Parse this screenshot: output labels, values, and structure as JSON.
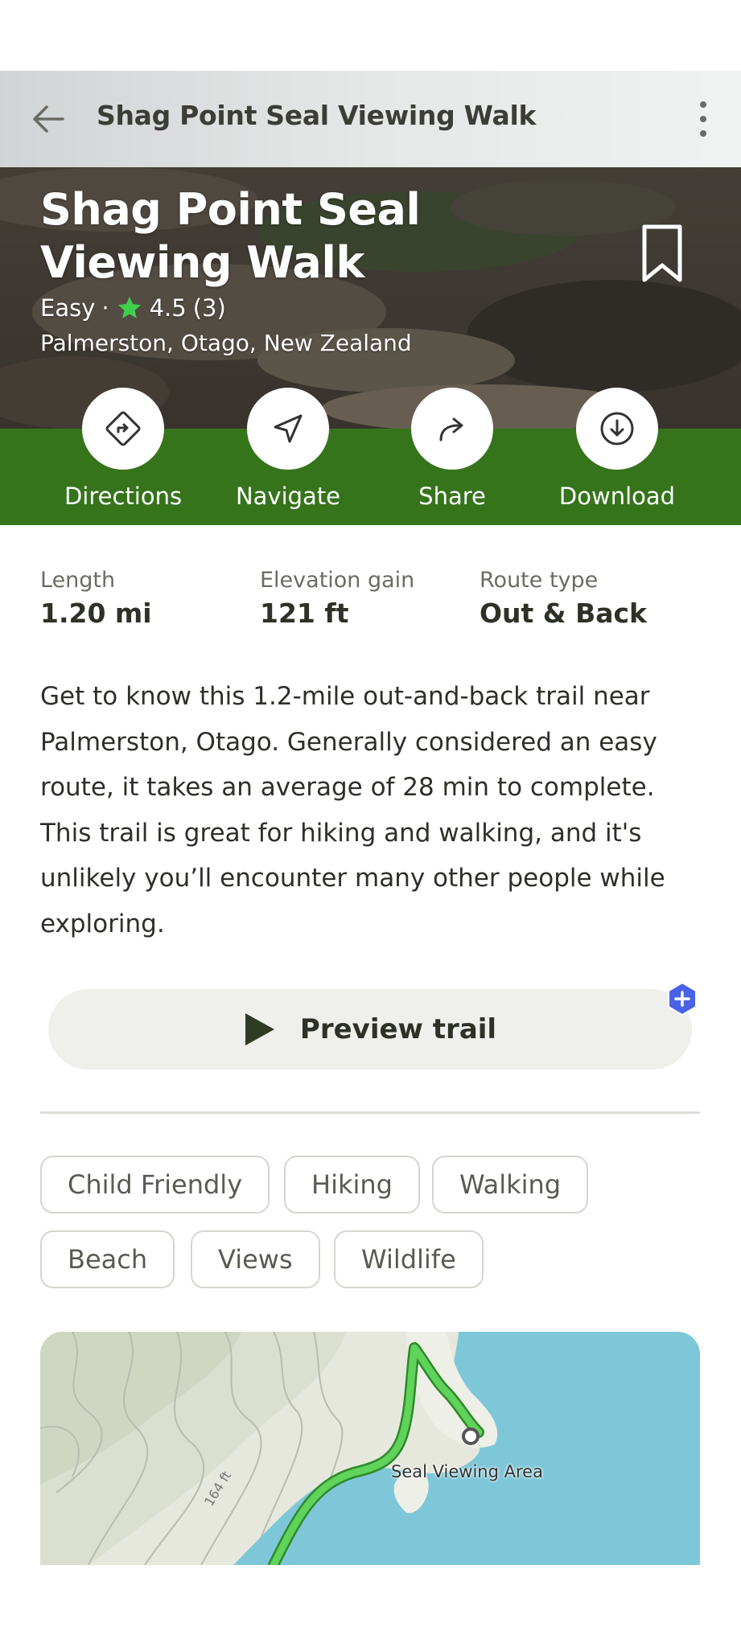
{
  "topbar": {
    "title": "Shag Point Seal Viewing Walk"
  },
  "hero": {
    "title": "Shag Point Seal Viewing Walk",
    "difficulty": "Easy",
    "separator": "·",
    "rating": "4.5",
    "review_count": "(3)",
    "location": "Palmerston, Otago, New Zealand"
  },
  "actions": [
    {
      "label": "Directions",
      "icon": "directions-icon"
    },
    {
      "label": "Navigate",
      "icon": "navigate-icon"
    },
    {
      "label": "Share",
      "icon": "share-icon"
    },
    {
      "label": "Download",
      "icon": "download-icon"
    }
  ],
  "stats": [
    {
      "label": "Length",
      "value": "1.20 mi"
    },
    {
      "label": "Elevation gain",
      "value": "121 ft"
    },
    {
      "label": "Route type",
      "value": "Out & Back"
    }
  ],
  "description": "Get to know this 1.2-mile out-and-back trail near Palmerston, Otago. Generally considered an easy route, it takes an average of 28 min to complete. This trail is great for hiking and walking, and it's unlikely you’ll encounter many other people while exploring.",
  "preview_button": {
    "label": "Preview trail"
  },
  "tags": [
    "Child Friendly",
    "Hiking",
    "Walking",
    "Beach",
    "Views",
    "Wildlife"
  ],
  "map": {
    "poi_label": "Seal Viewing Area",
    "contour_label": "164 ft"
  },
  "colors": {
    "brand_green": "#3b7a1f",
    "trail_green": "#5fd35a",
    "water": "#7ec7d8",
    "chip_border": "#d6d6d1",
    "badge_blue": "#4a63e6"
  }
}
